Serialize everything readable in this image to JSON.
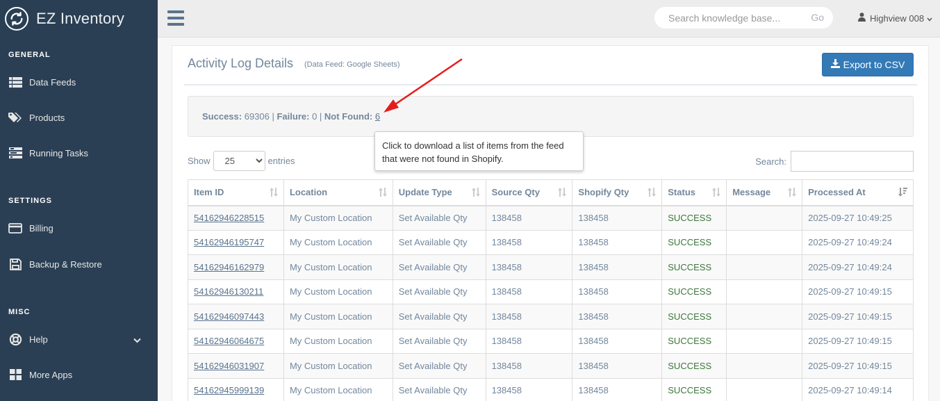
{
  "app": {
    "name": "EZ Inventory"
  },
  "sidebar": {
    "sections": [
      {
        "title": "GENERAL"
      },
      {
        "title": "SETTINGS"
      },
      {
        "title": "MISC"
      }
    ],
    "items": [
      {
        "label": "Data Feeds",
        "icon": "table-list-icon"
      },
      {
        "label": "Products",
        "icon": "tags-icon"
      },
      {
        "label": "Running Tasks",
        "icon": "tasks-icon"
      },
      {
        "label": "Billing",
        "icon": "credit-card-icon"
      },
      {
        "label": "Backup & Restore",
        "icon": "floppy-disk-icon"
      },
      {
        "label": "Help",
        "icon": "life-ring-icon"
      },
      {
        "label": "More Apps",
        "icon": "grid-icon"
      }
    ]
  },
  "topbar": {
    "search_placeholder": "Search knowledge base...",
    "search_button": "Go",
    "user_name": "Highview 008"
  },
  "panel": {
    "title": "Activity Log Details",
    "subtitle": "(Data Feed: Google Sheets)",
    "export_label": "Export to CSV"
  },
  "summary": {
    "success_label": "Success:",
    "success_value": "69306",
    "failure_label": "Failure:",
    "failure_value": "0",
    "not_found_label": "Not Found:",
    "not_found_value": "6"
  },
  "tooltip": {
    "text": "Click to download a list of items from the feed that were not found in Shopify."
  },
  "table_controls": {
    "show_label": "Show",
    "entries_value": "25",
    "entries_label": "entries",
    "search_label": "Search:"
  },
  "table": {
    "columns": [
      "Item ID",
      "Location",
      "Update Type",
      "Source Qty",
      "Shopify Qty",
      "Status",
      "Message",
      "Processed At"
    ],
    "rows": [
      {
        "item_id": "54162946228515",
        "location": "My Custom Location",
        "update_type": "Set Available Qty",
        "source_qty": "138458",
        "shopify_qty": "138458",
        "status": "SUCCESS",
        "message": "",
        "processed_at": "2025-09-27 10:49:25"
      },
      {
        "item_id": "54162946195747",
        "location": "My Custom Location",
        "update_type": "Set Available Qty",
        "source_qty": "138458",
        "shopify_qty": "138458",
        "status": "SUCCESS",
        "message": "",
        "processed_at": "2025-09-27 10:49:24"
      },
      {
        "item_id": "54162946162979",
        "location": "My Custom Location",
        "update_type": "Set Available Qty",
        "source_qty": "138458",
        "shopify_qty": "138458",
        "status": "SUCCESS",
        "message": "",
        "processed_at": "2025-09-27 10:49:24"
      },
      {
        "item_id": "54162946130211",
        "location": "My Custom Location",
        "update_type": "Set Available Qty",
        "source_qty": "138458",
        "shopify_qty": "138458",
        "status": "SUCCESS",
        "message": "",
        "processed_at": "2025-09-27 10:49:15"
      },
      {
        "item_id": "54162946097443",
        "location": "My Custom Location",
        "update_type": "Set Available Qty",
        "source_qty": "138458",
        "shopify_qty": "138458",
        "status": "SUCCESS",
        "message": "",
        "processed_at": "2025-09-27 10:49:15"
      },
      {
        "item_id": "54162946064675",
        "location": "My Custom Location",
        "update_type": "Set Available Qty",
        "source_qty": "138458",
        "shopify_qty": "138458",
        "status": "SUCCESS",
        "message": "",
        "processed_at": "2025-09-27 10:49:15"
      },
      {
        "item_id": "54162946031907",
        "location": "My Custom Location",
        "update_type": "Set Available Qty",
        "source_qty": "138458",
        "shopify_qty": "138458",
        "status": "SUCCESS",
        "message": "",
        "processed_at": "2025-09-27 10:49:15"
      },
      {
        "item_id": "54162945999139",
        "location": "My Custom Location",
        "update_type": "Set Available Qty",
        "source_qty": "138458",
        "shopify_qty": "138458",
        "status": "SUCCESS",
        "message": "",
        "processed_at": "2025-09-27 10:49:14"
      }
    ]
  },
  "colors": {
    "sidebar_bg": "#2a3f54",
    "primary_button": "#337ab7",
    "success_text": "#3c763d",
    "annotation_arrow": "#e51c1c"
  }
}
